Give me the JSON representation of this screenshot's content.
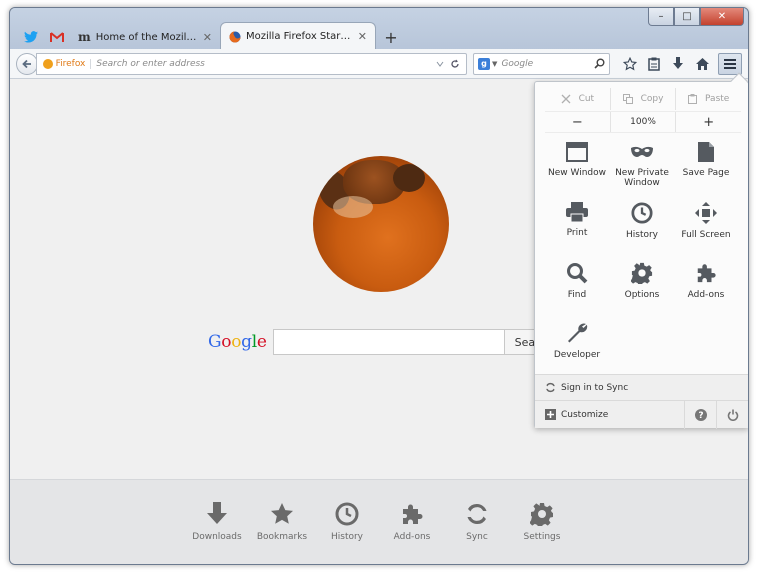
{
  "window": {
    "controls": {
      "minimize": "–",
      "maximize": "□",
      "close": "✕"
    }
  },
  "tabs": {
    "pinned": [
      {
        "icon": "twitter-icon",
        "color": "#1da1f2"
      },
      {
        "icon": "gmail-icon",
        "color": "#d93025"
      }
    ],
    "items": [
      {
        "label": "Home of the Mozilla Proje...",
        "icon": "mozilla-icon",
        "active": false
      },
      {
        "label": "Mozilla Firefox Start Page",
        "icon": "firefox-icon",
        "active": true
      }
    ],
    "close_glyph": "✕",
    "new_tab_glyph": "+"
  },
  "navbar": {
    "identity_label": "Firefox",
    "url_placeholder": "Search or enter address",
    "search_engine_letter": "g",
    "search_placeholder": "Google"
  },
  "content": {
    "google_button": "Sear",
    "google_logo": "Google"
  },
  "launcher": {
    "items": [
      {
        "label": "Downloads",
        "icon": "download-icon"
      },
      {
        "label": "Bookmarks",
        "icon": "star-icon"
      },
      {
        "label": "History",
        "icon": "clock-icon"
      },
      {
        "label": "Add-ons",
        "icon": "puzzle-icon"
      },
      {
        "label": "Sync",
        "icon": "sync-icon"
      },
      {
        "label": "Settings",
        "icon": "gear-icon"
      }
    ]
  },
  "menu_panel": {
    "edit": {
      "cut": "Cut",
      "copy": "Copy",
      "paste": "Paste"
    },
    "zoom": {
      "minus": "−",
      "level": "100%",
      "plus": "+"
    },
    "items": [
      {
        "label": "New Window",
        "icon": "window-icon"
      },
      {
        "label": "New Private Window",
        "icon": "mask-icon"
      },
      {
        "label": "Save Page",
        "icon": "page-icon"
      },
      {
        "label": "Print",
        "icon": "printer-icon"
      },
      {
        "label": "History",
        "icon": "clock-icon"
      },
      {
        "label": "Full Screen",
        "icon": "fullscreen-icon"
      },
      {
        "label": "Find",
        "icon": "magnifier-icon"
      },
      {
        "label": "Options",
        "icon": "gear-icon"
      },
      {
        "label": "Add-ons",
        "icon": "puzzle-icon"
      },
      {
        "label": "Developer",
        "icon": "wrench-icon"
      }
    ],
    "sync_label": "Sign in to Sync",
    "customize_label": "Customize"
  },
  "colors": {
    "accent_orange": "#e07a16",
    "icon_gray": "#555a60",
    "titlebar_blue": "#b9c6d8"
  }
}
